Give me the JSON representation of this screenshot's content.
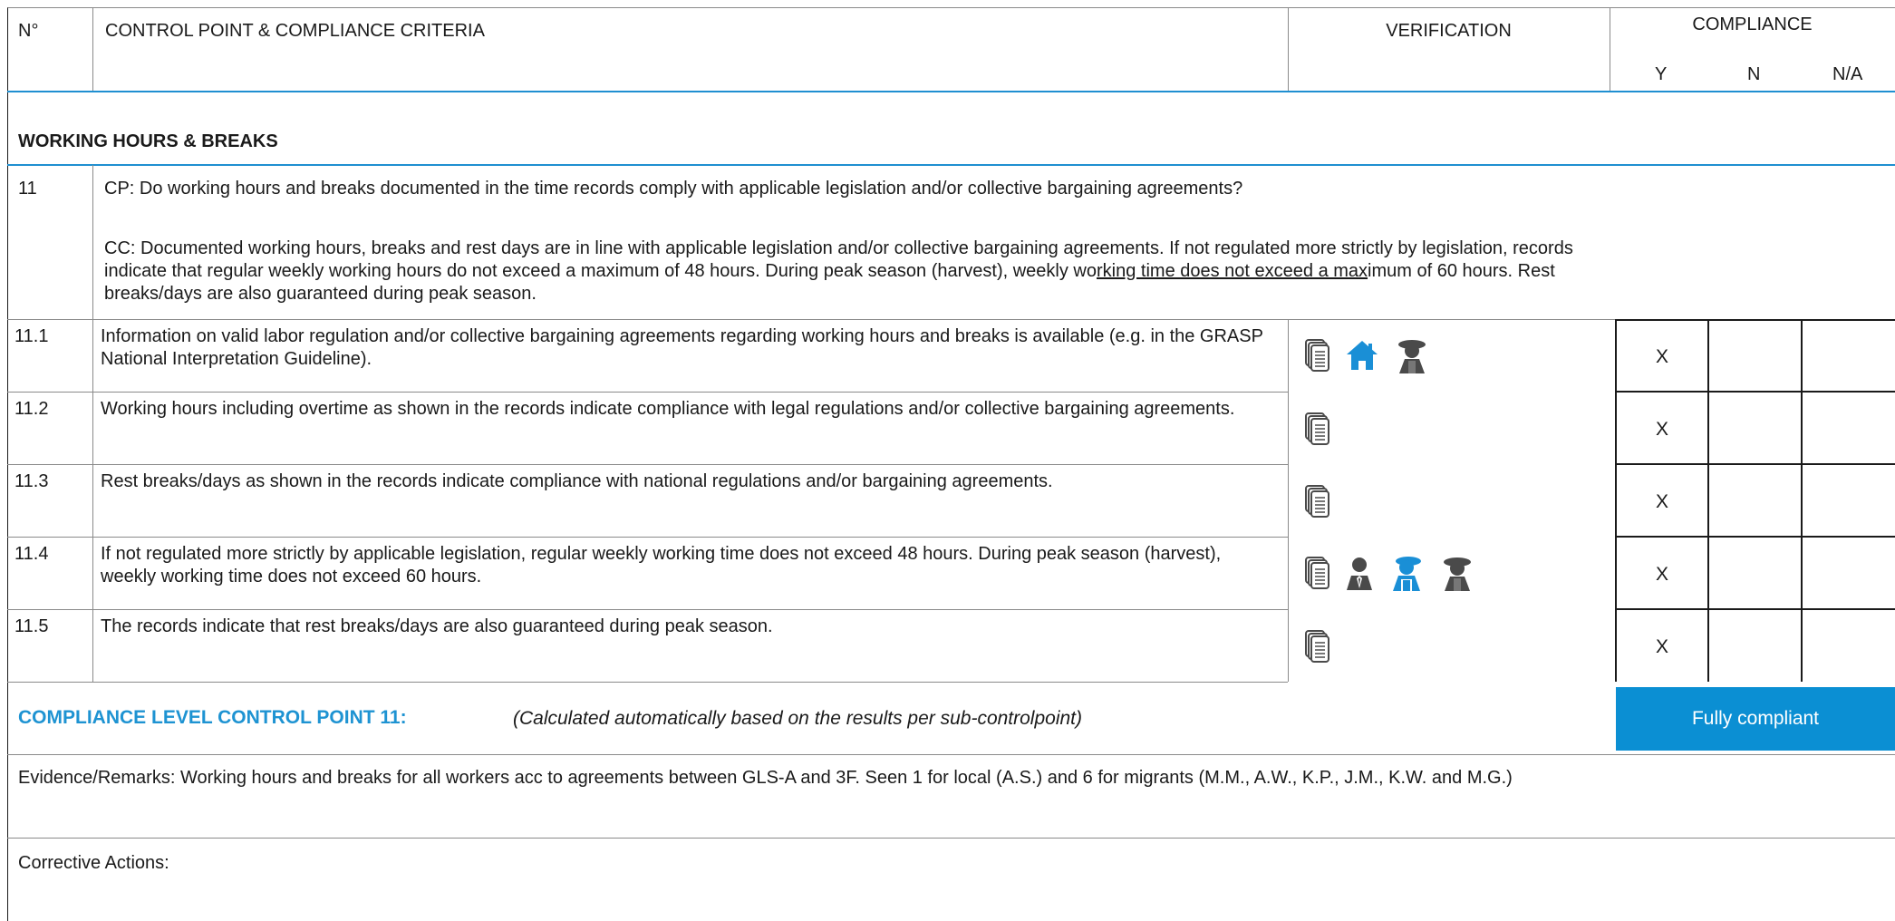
{
  "header": {
    "number": "N°",
    "control_point": "CONTROL POINT & COMPLIANCE CRITERIA",
    "verification": "VERIFICATION",
    "compliance": "COMPLIANCE",
    "y": "Y",
    "n": "N",
    "na": "N/A"
  },
  "section_title": "WORKING HOURS & BREAKS",
  "control_point": {
    "number": "11",
    "cp": "CP: Do working hours and breaks documented in the time records comply with applicable legislation and/or collective bargaining agreements?",
    "cc_line1": "CC: Documented working hours, breaks and rest days are in line with applicable legislation and/or collective bargaining agreements. If not regulated more strictly by legislation, records",
    "cc_line2_a": "indicate that regular weekly working hours do not exceed a maximum of 48 hours. During peak season (harvest), weekly wo",
    "cc_line2_b": "rking time does not exceed a max",
    "cc_line2_c": "imum of 60 hours. Rest",
    "cc_line3": "breaks/days are also guaranteed during peak season."
  },
  "rows": [
    {
      "number": "11.1",
      "text": "Information on valid labor regulation and/or collective bargaining agreements regarding working hours and breaks is available (e.g. in the GRASP National Interpretation Guideline).",
      "y": "X",
      "n": "",
      "na": "",
      "icons": [
        "documents-icon",
        "house-icon",
        "worker-woman-icon"
      ]
    },
    {
      "number": "11.2",
      "text": "Working hours including overtime as shown in the records indicate compliance with legal regulations and/or collective bargaining agreements.",
      "y": "X",
      "n": "",
      "na": "",
      "icons": [
        "documents-icon"
      ]
    },
    {
      "number": "11.3",
      "text": "Rest breaks/days as shown in the records indicate compliance with national regulations and/or bargaining agreements.",
      "y": "X",
      "n": "",
      "na": "",
      "icons": [
        "documents-icon"
      ]
    },
    {
      "number": "11.4",
      "text": "If not regulated more strictly by applicable legislation, regular weekly working time does not exceed 48 hours. During peak season (harvest), weekly working time does not exceed 60 hours.",
      "y": "X",
      "n": "",
      "na": "",
      "icons": [
        "documents-icon",
        "manager-icon",
        "worker-man-icon",
        "worker-woman-icon"
      ]
    },
    {
      "number": "11.5",
      "text": "The records indicate that rest breaks/days are also guaranteed during peak season.",
      "y": "X",
      "n": "",
      "na": "",
      "icons": [
        "documents-icon"
      ]
    }
  ],
  "compliance_level": {
    "label": "COMPLIANCE LEVEL CONTROL POINT 11:",
    "note": "(Calculated automatically based on the results per sub-controlpoint)",
    "value": "Fully compliant"
  },
  "evidence": "Evidence/Remarks: Working hours and breaks for all workers acc to agreements between GLS-A and 3F. Seen 1 for local (A.S.) and 6 for migrants (M.M., A.W., K.P., J.M., K.W. and M.G.)",
  "corrective_actions": "Corrective Actions:",
  "colors": {
    "accent": "#1e93d2",
    "compliance_box": "#0b8fd3",
    "icon_gray": "#4a4a4a",
    "icon_blue": "#1a8fd6"
  }
}
